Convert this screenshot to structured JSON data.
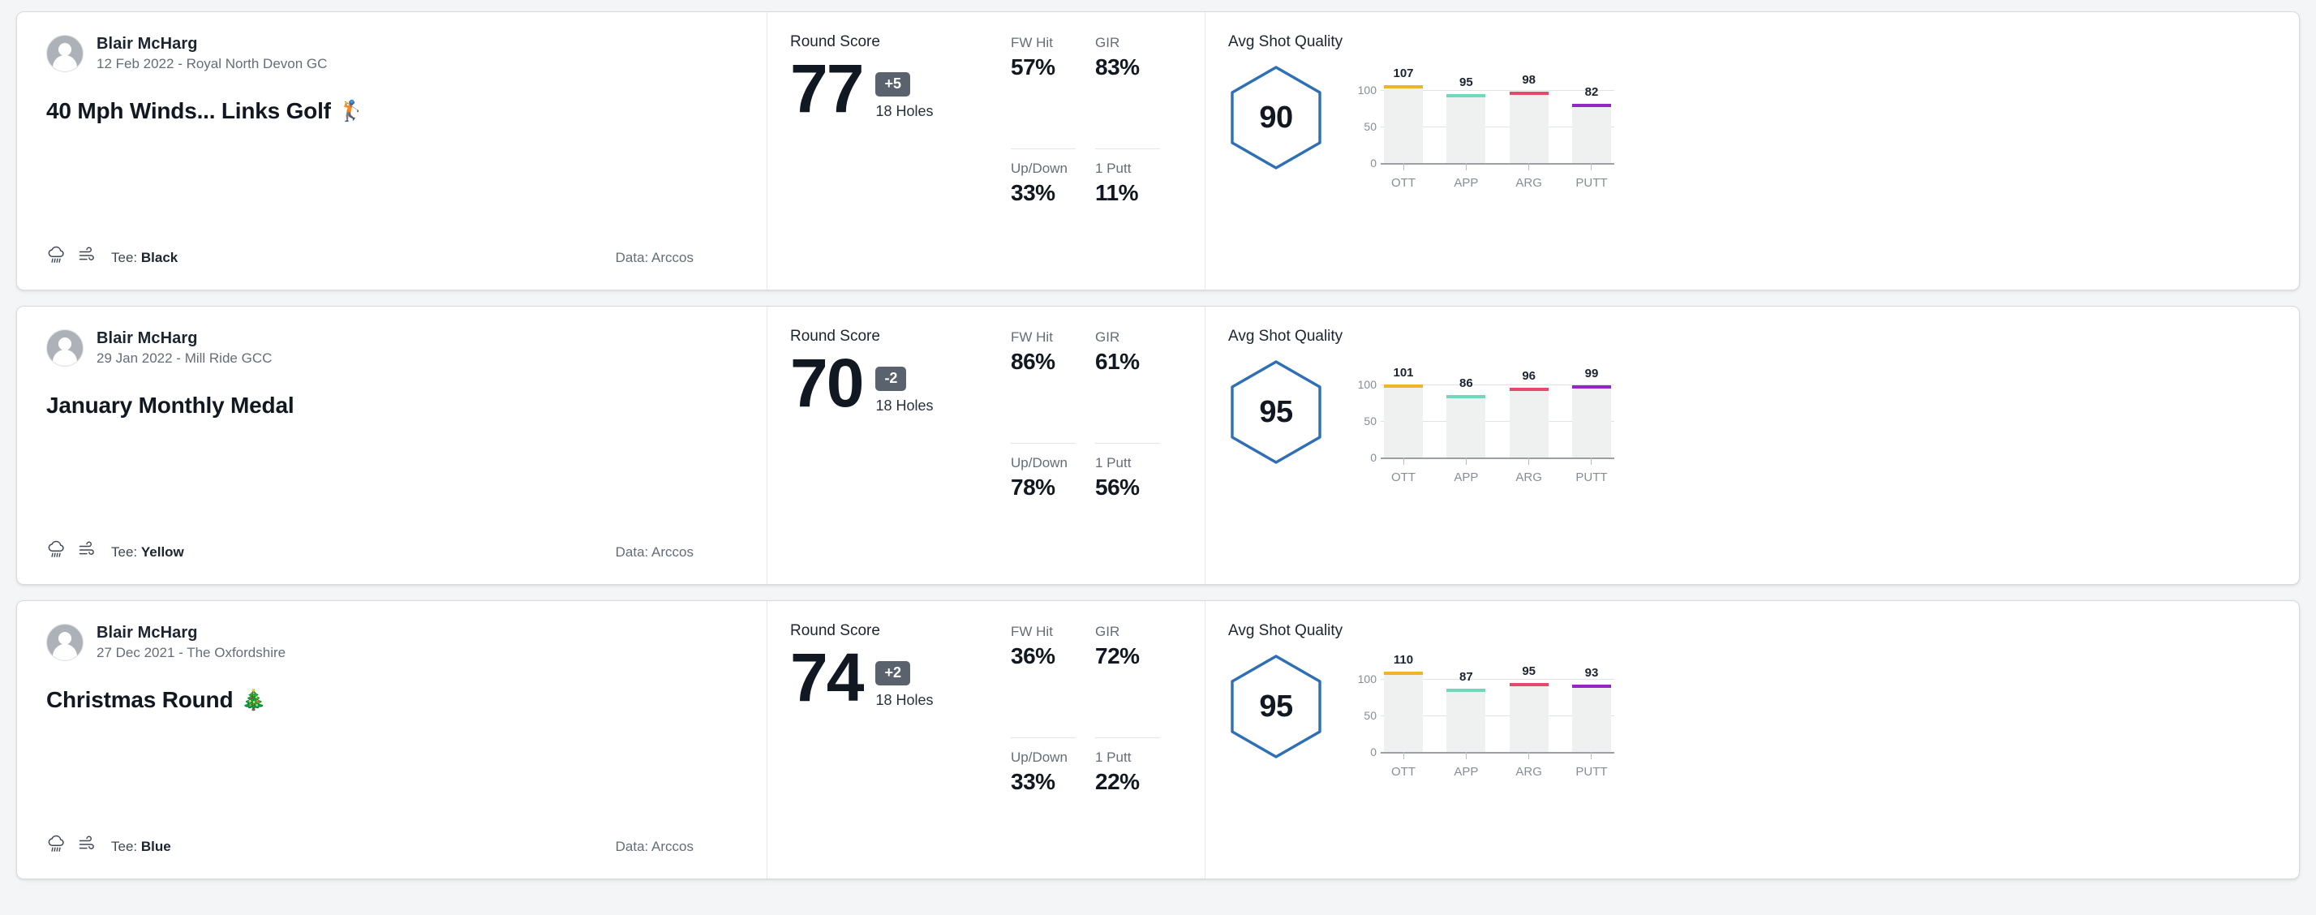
{
  "labels": {
    "round_score": "Round Score",
    "holes": "18 Holes",
    "avg_shot_quality": "Avg Shot Quality",
    "fw_hit": "FW Hit",
    "gir": "GIR",
    "up_down": "Up/Down",
    "one_putt": "1 Putt",
    "tee_prefix": "Tee: ",
    "data_prefix": "Data: "
  },
  "colors": {
    "ott": "#f0b429",
    "app": "#6fd9bb",
    "arg": "#e8496b",
    "putt": "#9327c4",
    "hexagon_stroke": "#2f6fb5",
    "score_badge": "#5a626e",
    "bar_track": "#eff0f0"
  },
  "chart_axis": {
    "ticks": [
      "100",
      "50",
      "0"
    ],
    "categories": [
      "OTT",
      "APP",
      "ARG",
      "PUTT"
    ],
    "ymin": 0,
    "ymax": 125
  },
  "rounds": [
    {
      "author": "Blair McHarg",
      "meta": "12 Feb 2022 - Royal North Devon GC",
      "title": "40 Mph Winds... Links Golf",
      "title_emoji": "🏌️",
      "weather_icons": [
        "rain-cloud-icon",
        "wind-icon"
      ],
      "tee": "Black",
      "data_source": "Arccos",
      "score": "77",
      "diff": "+5",
      "holes": "18 Holes",
      "stats": {
        "fw_hit": "57%",
        "gir": "83%",
        "up_down": "33%",
        "one_putt": "11%"
      },
      "avg_quality": "90",
      "chart_data": {
        "type": "bar",
        "title": "Avg Shot Quality",
        "categories": [
          "OTT",
          "APP",
          "ARG",
          "PUTT"
        ],
        "values": [
          107,
          95,
          98,
          82
        ],
        "colors": [
          "#f0b429",
          "#6fd9bb",
          "#e8496b",
          "#9327c4"
        ],
        "ylabel": "",
        "xlabel": "",
        "ylim": [
          0,
          125
        ],
        "yticks": [
          0,
          50,
          100
        ],
        "grid": true,
        "legend": "none"
      }
    },
    {
      "author": "Blair McHarg",
      "meta": "29 Jan 2022 - Mill Ride GCC",
      "title": "January Monthly Medal",
      "title_emoji": "",
      "weather_icons": [
        "rain-cloud-icon",
        "wind-icon"
      ],
      "tee": "Yellow",
      "data_source": "Arccos",
      "score": "70",
      "diff": "-2",
      "holes": "18 Holes",
      "stats": {
        "fw_hit": "86%",
        "gir": "61%",
        "up_down": "78%",
        "one_putt": "56%"
      },
      "avg_quality": "95",
      "chart_data": {
        "type": "bar",
        "title": "Avg Shot Quality",
        "categories": [
          "OTT",
          "APP",
          "ARG",
          "PUTT"
        ],
        "values": [
          101,
          86,
          96,
          99
        ],
        "colors": [
          "#f0b429",
          "#6fd9bb",
          "#e8496b",
          "#9327c4"
        ],
        "ylabel": "",
        "xlabel": "",
        "ylim": [
          0,
          125
        ],
        "yticks": [
          0,
          50,
          100
        ],
        "grid": true,
        "legend": "none"
      }
    },
    {
      "author": "Blair McHarg",
      "meta": "27 Dec 2021 - The Oxfordshire",
      "title": "Christmas Round",
      "title_emoji": "🎄",
      "weather_icons": [
        "rain-cloud-icon",
        "wind-icon"
      ],
      "tee": "Blue",
      "data_source": "Arccos",
      "score": "74",
      "diff": "+2",
      "holes": "18 Holes",
      "stats": {
        "fw_hit": "36%",
        "gir": "72%",
        "up_down": "33%",
        "one_putt": "22%"
      },
      "avg_quality": "95",
      "chart_data": {
        "type": "bar",
        "title": "Avg Shot Quality",
        "categories": [
          "OTT",
          "APP",
          "ARG",
          "PUTT"
        ],
        "values": [
          110,
          87,
          95,
          93
        ],
        "colors": [
          "#f0b429",
          "#6fd9bb",
          "#e8496b",
          "#9327c4"
        ],
        "ylabel": "",
        "xlabel": "",
        "ylim": [
          0,
          125
        ],
        "yticks": [
          0,
          50,
          100
        ],
        "grid": true,
        "legend": "none"
      }
    }
  ]
}
